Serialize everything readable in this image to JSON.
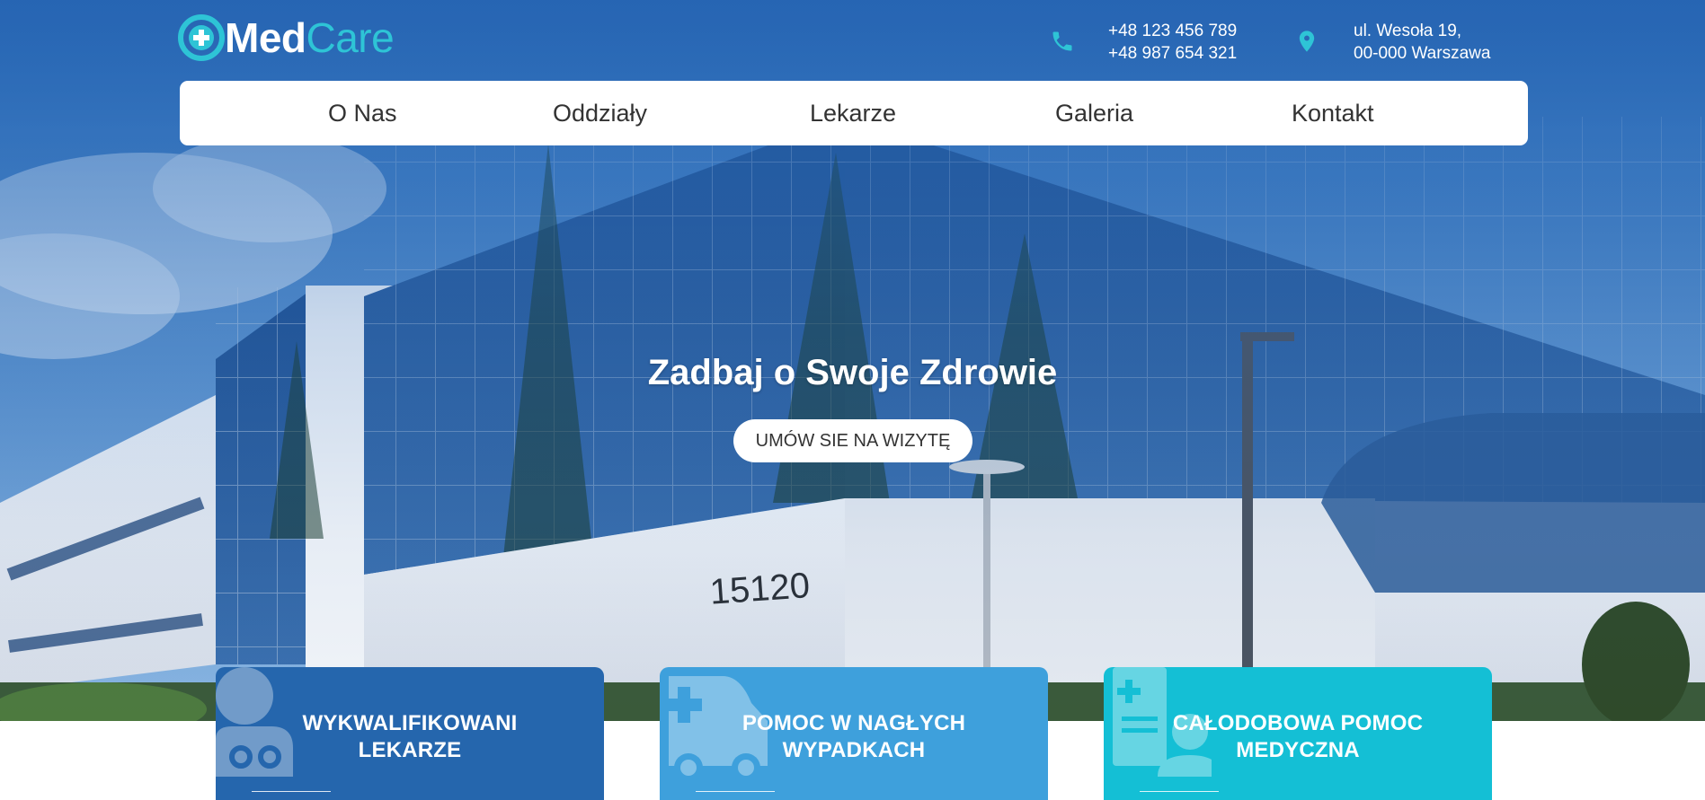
{
  "brand": {
    "name_part1": "Med",
    "name_part2": "Care",
    "logo_icon": "medical-cross-circle-icon",
    "accent_color": "#2ec4d6",
    "primary_color": "#2566ad"
  },
  "contact": {
    "phone_icon": "phone-icon",
    "phones": [
      "+48 123 456 789",
      "+48 987 654 321"
    ],
    "address_icon": "location-pin-icon",
    "address_lines": [
      "ul. Wesoła 19,",
      "00-000 Warszawa"
    ]
  },
  "nav": {
    "items": [
      {
        "label": "O Nas"
      },
      {
        "label": "Oddziały"
      },
      {
        "label": "Lekarze"
      },
      {
        "label": "Galeria"
      },
      {
        "label": "Kontakt"
      }
    ]
  },
  "hero": {
    "title": "Zadbaj o Swoje Zdrowie",
    "cta_label": "UMÓW SIE NA WIZYTĘ",
    "building_number": "15120"
  },
  "features": [
    {
      "line1": "WYKWALIFIKOWANI",
      "line2": "LEKARZE",
      "icon": "doctor-icon",
      "color": "#2566ad"
    },
    {
      "line1": "POMOC  W  NAGŁYCH",
      "line2": "WYPADKACH",
      "icon": "ambulance-icon",
      "color": "#3ea0dc"
    },
    {
      "line1": "CAŁODOBOWA  POMOC",
      "line2": "MEDYCZNA",
      "icon": "medical-record-icon",
      "color": "#14bfd5"
    }
  ]
}
